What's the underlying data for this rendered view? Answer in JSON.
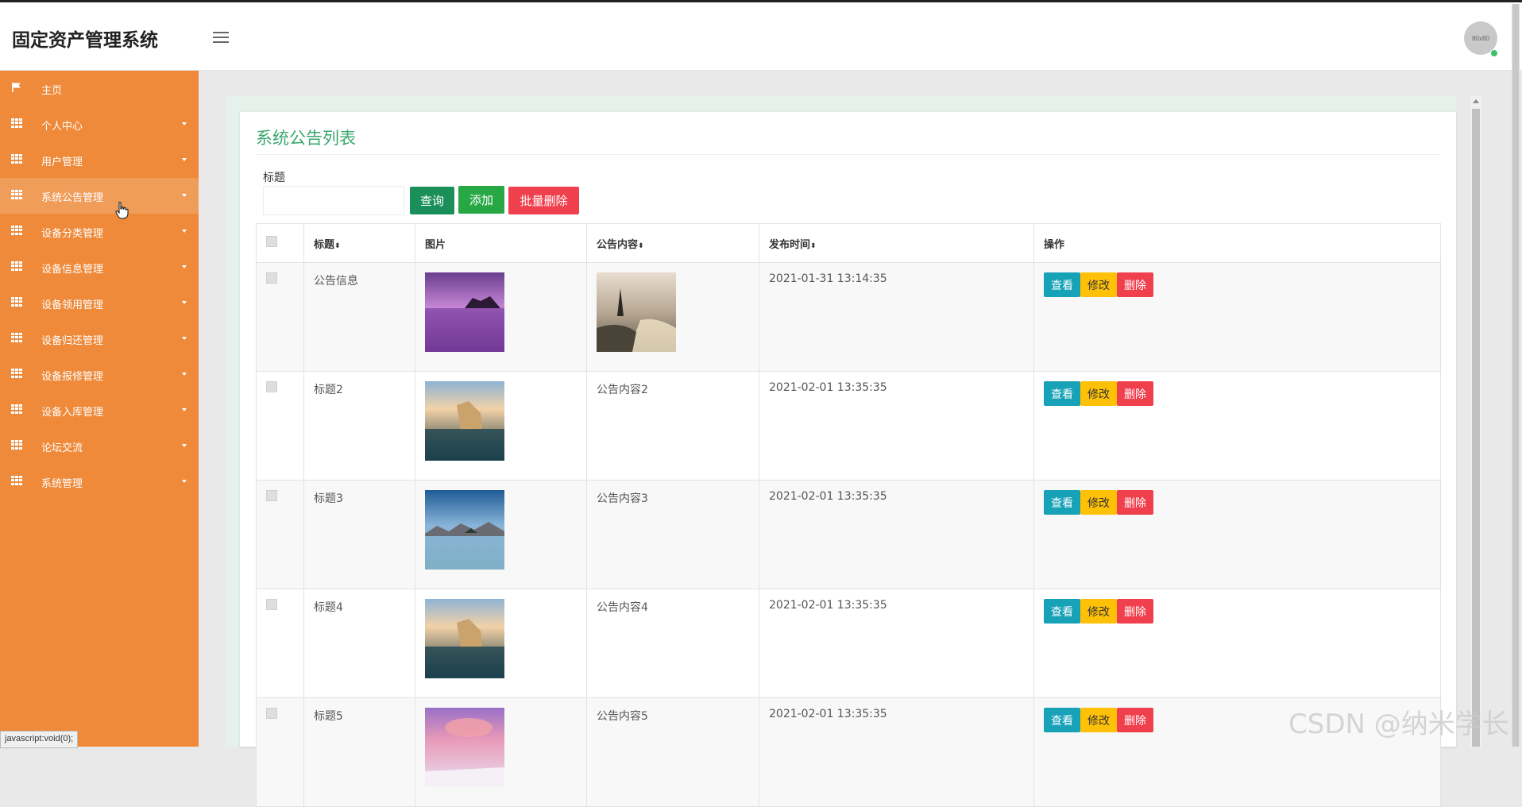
{
  "app": {
    "title": "固定资产管理系统",
    "avatar_text": "80x80"
  },
  "sidebar": {
    "items": [
      {
        "label": "主页",
        "icon": "flag-icon",
        "has_submenu": false
      },
      {
        "label": "个人中心",
        "icon": "grid-icon",
        "has_submenu": true
      },
      {
        "label": "用户管理",
        "icon": "grid-icon",
        "has_submenu": true
      },
      {
        "label": "系统公告管理",
        "icon": "grid-icon",
        "has_submenu": true
      },
      {
        "label": "设备分类管理",
        "icon": "grid-icon",
        "has_submenu": true
      },
      {
        "label": "设备信息管理",
        "icon": "grid-icon",
        "has_submenu": true
      },
      {
        "label": "设备领用管理",
        "icon": "grid-icon",
        "has_submenu": true
      },
      {
        "label": "设备归还管理",
        "icon": "grid-icon",
        "has_submenu": true
      },
      {
        "label": "设备报修管理",
        "icon": "grid-icon",
        "has_submenu": true
      },
      {
        "label": "设备入库管理",
        "icon": "grid-icon",
        "has_submenu": true
      },
      {
        "label": "论坛交流",
        "icon": "grid-icon",
        "has_submenu": true
      },
      {
        "label": "系统管理",
        "icon": "grid-icon",
        "has_submenu": true
      }
    ]
  },
  "panel": {
    "title": "系统公告列表"
  },
  "search": {
    "label": "标题",
    "value": "",
    "placeholder": ""
  },
  "toolbar": {
    "query_label": "查询",
    "add_label": "添加",
    "batch_delete_label": "批量删除"
  },
  "table": {
    "headers": {
      "title": "标题",
      "image": "图片",
      "content": "公告内容",
      "time": "发布时间",
      "actions": "操作"
    },
    "sort_arrow": "⬍",
    "action_labels": {
      "view": "查看",
      "edit": "修改",
      "delete": "删除"
    },
    "rows": [
      {
        "title": "公告信息",
        "image": "purple-sea-rock",
        "content": "",
        "content_image": "misty-lake-tree",
        "time": "2021-01-31 13:14:35"
      },
      {
        "title": "标题2",
        "image": "island-lake-sunset",
        "content": "公告内容2",
        "time": "2021-02-01 13:35:35"
      },
      {
        "title": "标题3",
        "image": "mountain-lake",
        "content": "公告内容3",
        "time": "2021-02-01 13:35:35"
      },
      {
        "title": "标题4",
        "image": "island-lake-sunset",
        "content": "公告内容4",
        "time": "2021-02-01 13:35:35"
      },
      {
        "title": "标题5",
        "image": "pink-sky-snow",
        "content": "公告内容5",
        "time": "2021-02-01 13:35:35"
      }
    ]
  },
  "status_bar": {
    "url": "javascript:void(0);"
  },
  "watermark": "CSDN @纳米学长",
  "colors": {
    "sidebar": "#ee8a3a",
    "title": "#3aa76d",
    "view": "#17a2b8",
    "edit": "#ffc107",
    "delete": "#f0404e"
  }
}
